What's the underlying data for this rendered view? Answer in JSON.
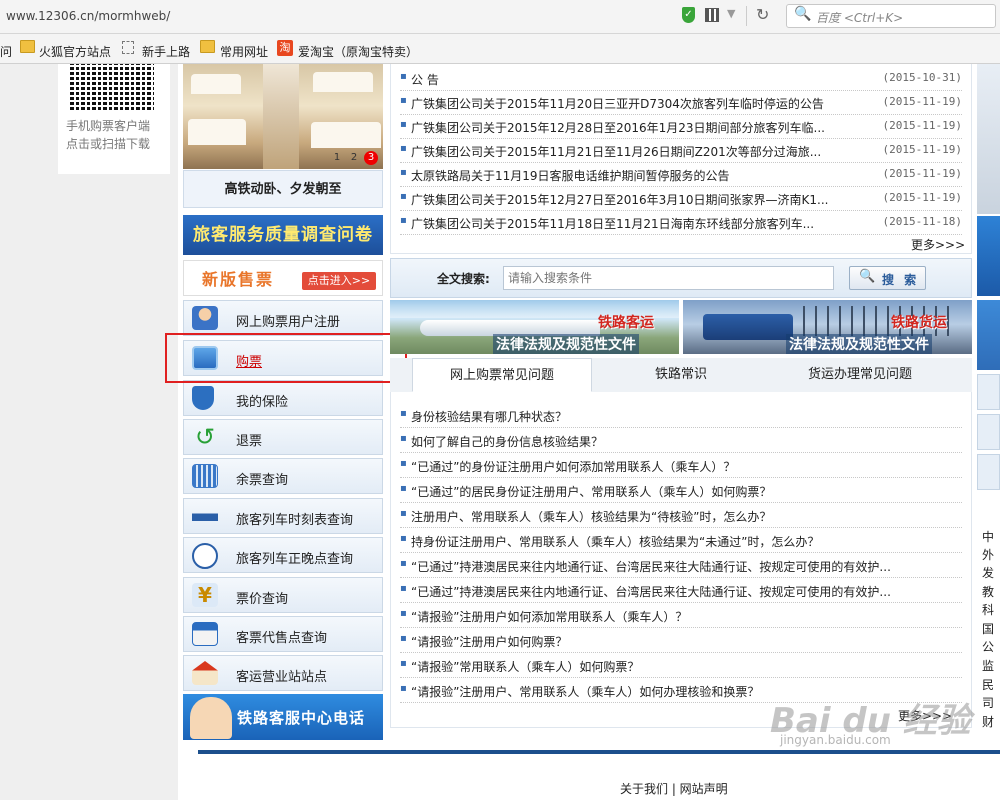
{
  "browser": {
    "url": "www.12306.cn/mormhweb/",
    "search_placeholder": "百度 <Ctrl+K>",
    "bookmarks": [
      "问",
      "火狐官方站点",
      "新手上路",
      "常用网址",
      "爱淘宝（原淘宝特卖）"
    ]
  },
  "qr": {
    "line1": "手机购票客户端",
    "line2": "点击或扫描下载"
  },
  "hero": {
    "caption": "高铁动卧、夕发朝至",
    "slides": [
      "1",
      "2",
      "3"
    ],
    "active_slide": 3
  },
  "survey_banner": "旅客服务质量调查问卷",
  "new_version": {
    "label": "新版售票",
    "button": "点击进入>>"
  },
  "nav": [
    {
      "label": "网上购票用户注册",
      "icon": "user-register-icon"
    },
    {
      "label": "购票",
      "icon": "ticket-buy-icon",
      "highlighted": true
    },
    {
      "label": "我的保险",
      "icon": "insurance-shield-icon"
    },
    {
      "label": "退票",
      "icon": "refund-arrow-icon"
    },
    {
      "label": "余票查询",
      "icon": "ticket-query-icon"
    },
    {
      "label": "旅客列车时刻表查询",
      "icon": "train-timetable-icon"
    },
    {
      "label": "旅客列车正晚点查询",
      "icon": "clock-icon"
    },
    {
      "label": "票价查询",
      "icon": "fare-yen-icon"
    },
    {
      "label": "客票代售点查询",
      "icon": "agency-store-icon"
    },
    {
      "label": "客运营业站站点",
      "icon": "station-house-icon"
    }
  ],
  "service_banner": "铁路客服中心电话",
  "notices": [
    {
      "title": "公 告",
      "date": "(2015-10-31)"
    },
    {
      "title": "广铁集团公司关于2015年11月20日三亚开D7304次旅客列车临时停运的公告",
      "date": "(2015-11-19)"
    },
    {
      "title": "广铁集团公司关于2015年12月28日至2016年1月23日期间部分旅客列车临...",
      "date": "(2015-11-19)"
    },
    {
      "title": "广铁集团公司关于2015年11月21日至11月26日期间Z201次等部分过海旅...",
      "date": "(2015-11-19)"
    },
    {
      "title": "太原铁路局关于11月19日客服电话维护期间暂停服务的公告",
      "date": "(2015-11-19)"
    },
    {
      "title": "广铁集团公司关于2015年12月27日至2016年3月10日期间张家界—济南K1...",
      "date": "(2015-11-19)"
    },
    {
      "title": "广铁集团公司关于2015年11月18日至11月21日海南东环线部分旅客列车...",
      "date": "(2015-11-18)"
    }
  ],
  "more_label": "更多>>>",
  "fulltext_search": {
    "label": "全文搜索:",
    "placeholder": "请输入搜索条件",
    "button": "搜 索"
  },
  "law_banners": [
    {
      "title": "铁路客运",
      "subtitle": "法律法规及规范性文件"
    },
    {
      "title": "铁路货运",
      "subtitle": "法律法规及规范性文件"
    }
  ],
  "tabs": [
    {
      "label": "网上购票常见问题",
      "active": true
    },
    {
      "label": "铁路常识",
      "active": false
    },
    {
      "label": "货运办理常见问题",
      "active": false
    }
  ],
  "faqs": [
    "身份核验结果有哪几种状态？",
    "如何了解自己的身份信息核验结果？",
    "“已通过”的身份证注册用户如何添加常用联系人（乘车人）？",
    "“已通过”的居民身份证注册用户、常用联系人（乘车人）如何购票？",
    "注册用户、常用联系人（乘车人）核验结果为“待核验”时，怎么办？",
    "持身份证注册用户、常用联系人（乘车人）核验结果为“未通过”时，怎么办？",
    "“已通过”持港澳居民来往内地通行证、台湾居民来往大陆通行证、按规定可使用的有效护...",
    "“已通过”持港澳居民来往内地通行证、台湾居民来往大陆通行证、按规定可使用的有效护...",
    "“请报验”注册用户如何添加常用联系人（乘车人）？",
    "“请报验”注册用户如何购票？",
    "“请报验”常用联系人（乘车人）如何购票？",
    "“请报验”注册用户、常用联系人（乘车人）如何办理核验和换票？"
  ],
  "right_strip_chars": [
    "中",
    "外",
    "发",
    "教",
    "科",
    "国",
    "公",
    "监",
    "民",
    "司",
    "财"
  ],
  "footer": "关于我们 | 网站声明",
  "watermark": {
    "main": "Bai du 经验",
    "sub": "jingyan.baidu.com"
  },
  "colors": {
    "accent_blue": "#1d4f9a",
    "highlight_red": "#e02020",
    "link_red": "#cc0000",
    "new_version_orange": "#e9762b"
  }
}
